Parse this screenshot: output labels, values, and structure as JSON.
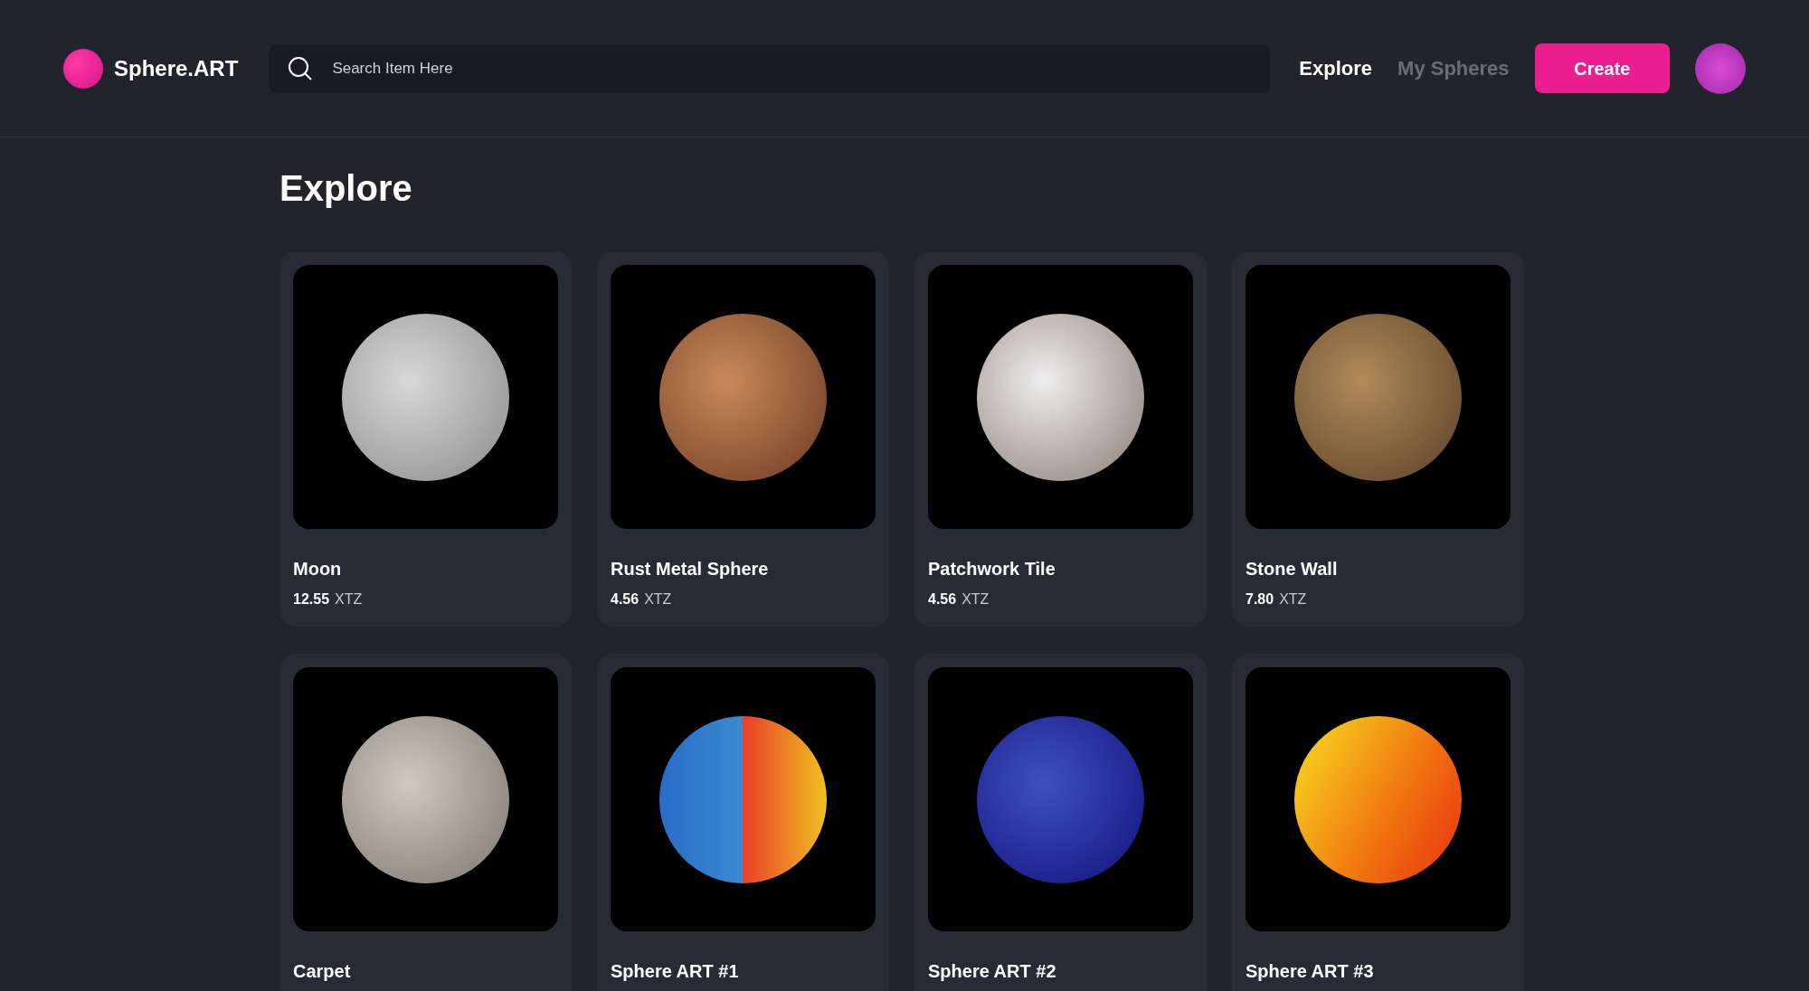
{
  "header": {
    "logo": "Sphere.ART",
    "search": {
      "placeholder": "Search Item Here"
    },
    "nav": [
      {
        "label": "Explore",
        "selected": true
      },
      {
        "label": "My Spheres",
        "selected": false
      }
    ],
    "create_button": "Create"
  },
  "page_title": "Explore",
  "items": [
    {
      "title": "Moon",
      "price": "12.55",
      "currency": "XTZ"
    },
    {
      "title": "Rust Metal Sphere",
      "price": "4.56",
      "currency": "XTZ"
    },
    {
      "title": "Patchwork Tile",
      "price": "4.56",
      "currency": "XTZ"
    },
    {
      "title": "Stone Wall",
      "price": "7.80",
      "currency": "XTZ"
    },
    {
      "title": "Carpet"
    },
    {
      "title": "Sphere ART #1"
    },
    {
      "title": "Sphere ART #2"
    },
    {
      "title": "Sphere ART #3"
    }
  ]
}
